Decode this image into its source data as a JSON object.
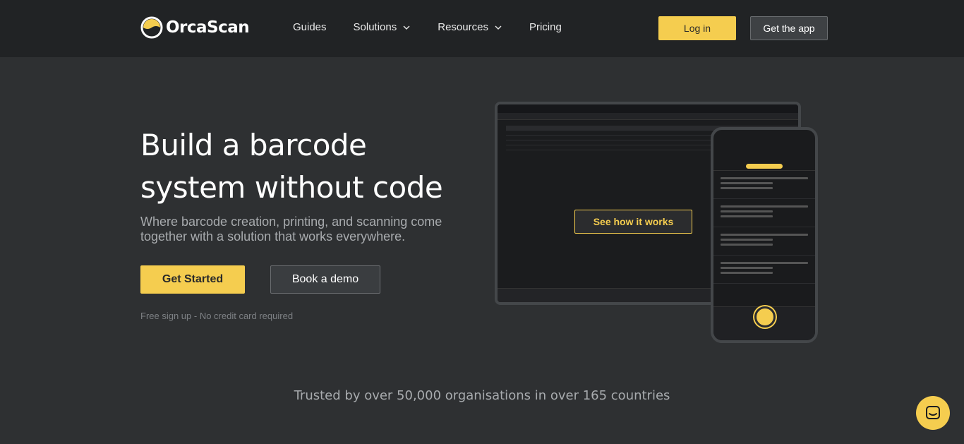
{
  "nav": {
    "logo_text": "OrcaScan",
    "links": [
      {
        "label": "Guides",
        "has_dropdown": false
      },
      {
        "label": "Solutions",
        "has_dropdown": true
      },
      {
        "label": "Resources",
        "has_dropdown": true
      },
      {
        "label": "Pricing",
        "has_dropdown": false
      }
    ],
    "login_label": "Log in",
    "app_label": "Get the app"
  },
  "hero": {
    "title_line1": "Build a barcode",
    "title_line2": "system without code",
    "subtitle": "Where barcode creation, printing, and scanning come together with a solution that works everywhere.",
    "primary_cta": "Get Started",
    "secondary_cta": "Book a demo",
    "note": "Free sign up - No credit card required",
    "video_cta": "See how it works"
  },
  "trust": {
    "text": "Trusted by over 50,000 organisations in over 165 countries"
  },
  "colors": {
    "accent": "#f5cd4f",
    "nav_bg": "#212325",
    "page_bg": "#2e3032"
  },
  "icons": {
    "chat": "chat-icon",
    "chevron": "chevron-down-icon",
    "logo": "orca-logo-icon"
  }
}
